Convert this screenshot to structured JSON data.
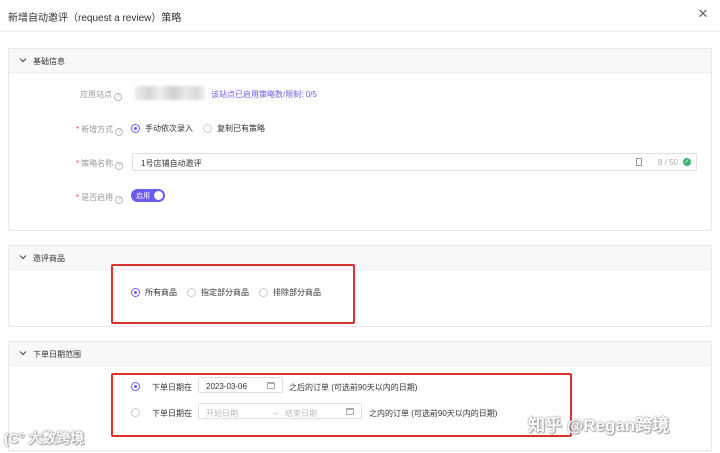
{
  "modal": {
    "title": "新增自动邀评（request a review）策略",
    "close_symbol": "✕"
  },
  "basic": {
    "title": "基础信息",
    "site_label": "应用站点",
    "site_link": "该站点已启用策略数/限制: 0/5",
    "method_label": "新增方式",
    "method_option_manual": "手动依次录入",
    "method_option_copy": "复制已有策略",
    "name_label": "策略名称",
    "name_value": "1号店铺自动邀评",
    "name_count": "8 / 50",
    "enable_label": "是否启用",
    "enable_toggle_text": "启用"
  },
  "products": {
    "title": "邀评商品",
    "option_all": "所有商品",
    "option_some": "指定部分商品",
    "option_exclude": "排除部分商品"
  },
  "dates": {
    "title": "下单日期范围",
    "row1_prefix": "下单日期在",
    "row1_date": "2023-03-06",
    "row1_suffix": "之后的订单 (可选前90天以内的日期)",
    "row2_prefix": "下单日期在",
    "row2_start_placeholder": "开始日期",
    "row2_arrow": "→",
    "row2_end_placeholder": "结束日期",
    "row2_suffix": "之内的订单 (可选前90天以内的日期)"
  },
  "watermarks": {
    "left": "(C° 大数跨境",
    "right": "知乎 @Regan跨境"
  },
  "colors": {
    "accent": "#6a5cf0",
    "required": "#f04a4a",
    "highlight_box": "#d9322b",
    "success": "#3cb371"
  },
  "icons": {
    "help": "question-circle-icon",
    "collapse": "chevron-down-icon",
    "calendar": "calendar-icon",
    "check": "check-circle-icon"
  }
}
